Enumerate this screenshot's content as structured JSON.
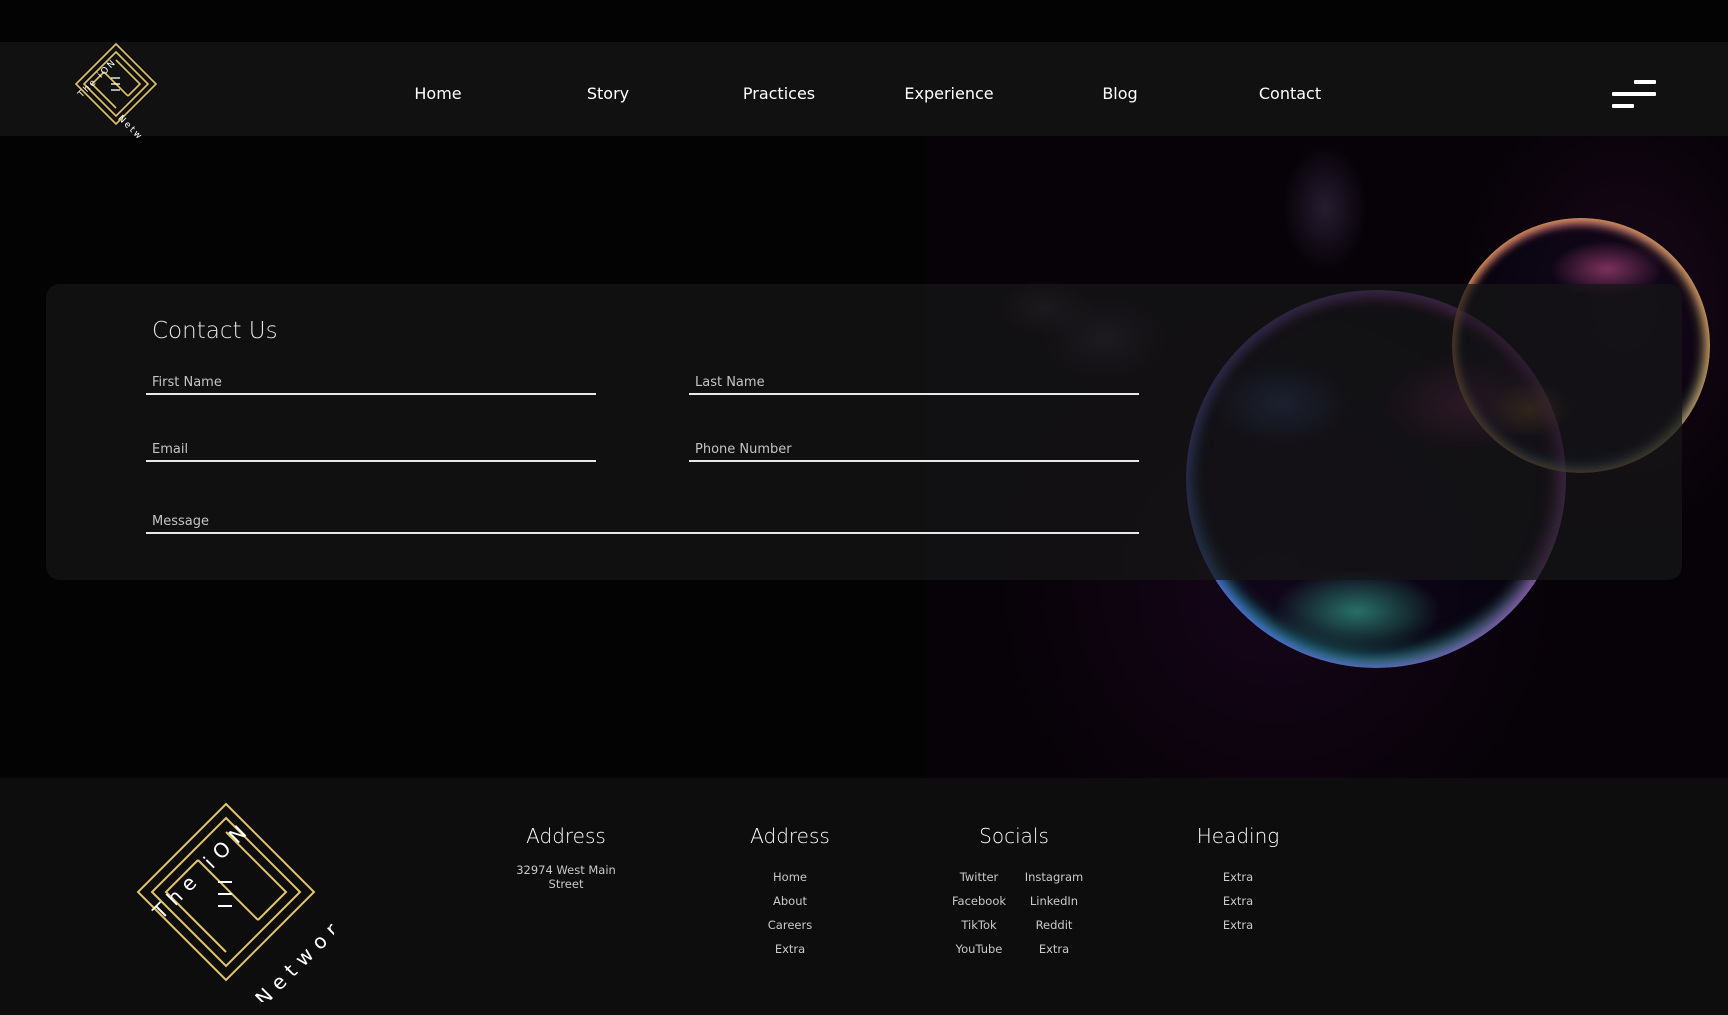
{
  "brand": {
    "logo_line1": "The iON",
    "logo_line2": "Network",
    "accent_color": "#e2c46b"
  },
  "nav": {
    "items": [
      "Home",
      "Story",
      "Practices",
      "Experience",
      "Blog",
      "Contact"
    ],
    "menu_icon": "hamburger-menu-icon"
  },
  "contact": {
    "title": "Contact Us",
    "first_name_placeholder": "First Name",
    "last_name_placeholder": "Last Name",
    "email_placeholder": "Email",
    "phone_placeholder": "Phone Number",
    "message_placeholder": "Message"
  },
  "footer": {
    "address": {
      "heading": "Address",
      "line": "32974 West Main Street"
    },
    "pages": {
      "heading": "Address",
      "links": [
        "Home",
        "About",
        "Careers",
        "Extra"
      ]
    },
    "socials": {
      "heading": "Socials",
      "col1": [
        "Twitter",
        "Facebook",
        "TikTok",
        "YouTube"
      ],
      "col2": [
        "Instagram",
        "LinkedIn",
        "Reddit",
        "Extra"
      ]
    },
    "extra": {
      "heading": "Heading",
      "links": [
        "Extra",
        "Extra",
        "Extra"
      ]
    }
  }
}
